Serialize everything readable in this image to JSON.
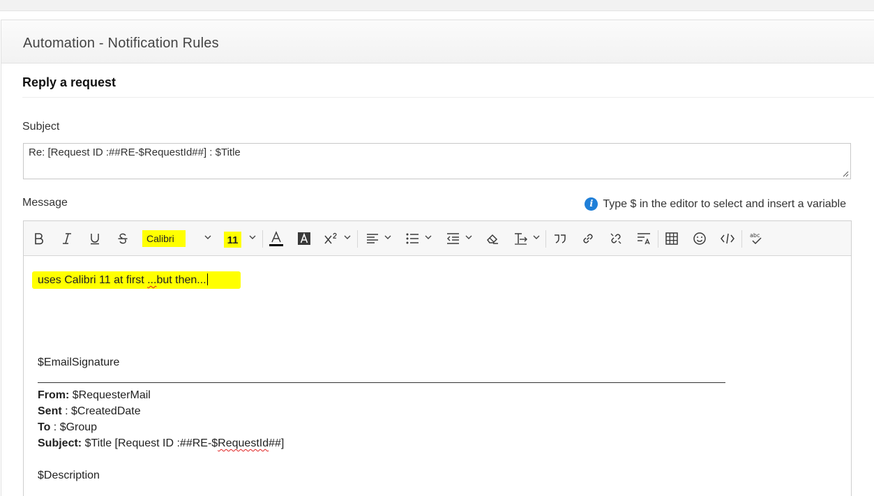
{
  "panel": {
    "title": "Automation - Notification Rules",
    "section_title": "Reply a request"
  },
  "subject": {
    "label": "Subject",
    "value": "Re: [Request ID :##RE-$RequestId##] : $Title"
  },
  "message": {
    "label": "Message",
    "hint": "Type $ in the editor to select and insert a variable"
  },
  "toolbar": {
    "font_family": "Calibri",
    "font_size": "11",
    "icons": [
      "bold-icon",
      "italic-icon",
      "underline-icon",
      "strikethrough-icon",
      "font-color-icon",
      "highlight-color-icon",
      "superscript-icon",
      "align-icon",
      "bullet-list-icon",
      "indent-icon",
      "clear-format-icon",
      "text-direction-icon",
      "quote-icon",
      "link-icon",
      "unlink-icon",
      "line-height-icon",
      "table-icon",
      "emoji-icon",
      "code-icon",
      "spellcheck-icon"
    ],
    "highlight_color": "#ffff00"
  },
  "editor": {
    "first_line_a": "uses Calibri 11 at first ",
    "first_line_b": "...",
    "first_line_c": "but then...",
    "signature_var": "$EmailSignature",
    "from_label": "From:",
    "from_value": " $RequesterMail",
    "sent_label": "Sent",
    "sent_value": " : $CreatedDate",
    "to_label": "To",
    "to_value": " : $Group",
    "subject_label": "Subject:",
    "subject_value_a": " $Title [Request ID :##RE-$",
    "subject_value_b": "RequestId",
    "subject_value_c": "##]",
    "description_var": "$Description"
  }
}
